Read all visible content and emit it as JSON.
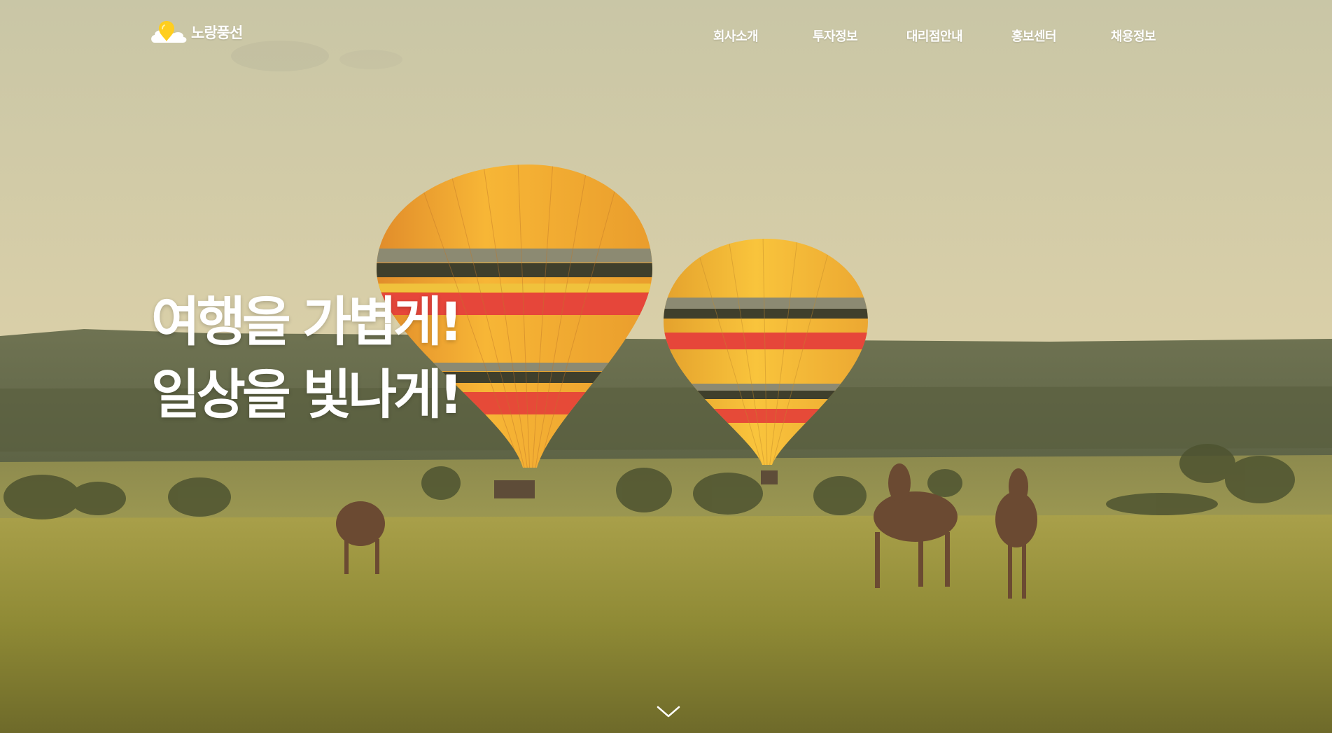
{
  "logo": {
    "text": "노랑풍선",
    "icon": "yellow-balloon-cloud-icon"
  },
  "nav": {
    "items": [
      {
        "label": "회사소개"
      },
      {
        "label": "투자정보"
      },
      {
        "label": "대리점안내"
      },
      {
        "label": "홍보센터"
      },
      {
        "label": "채용정보"
      }
    ]
  },
  "hero": {
    "headline_line1": "여행을 가볍게!",
    "headline_line2": "일상을 빛나게!",
    "background": "hot-air-balloons-savanna-image",
    "scroll_icon": "chevron-down-icon"
  },
  "colors": {
    "brand_yellow": "#ffce1f",
    "text_white": "#ffffff"
  }
}
